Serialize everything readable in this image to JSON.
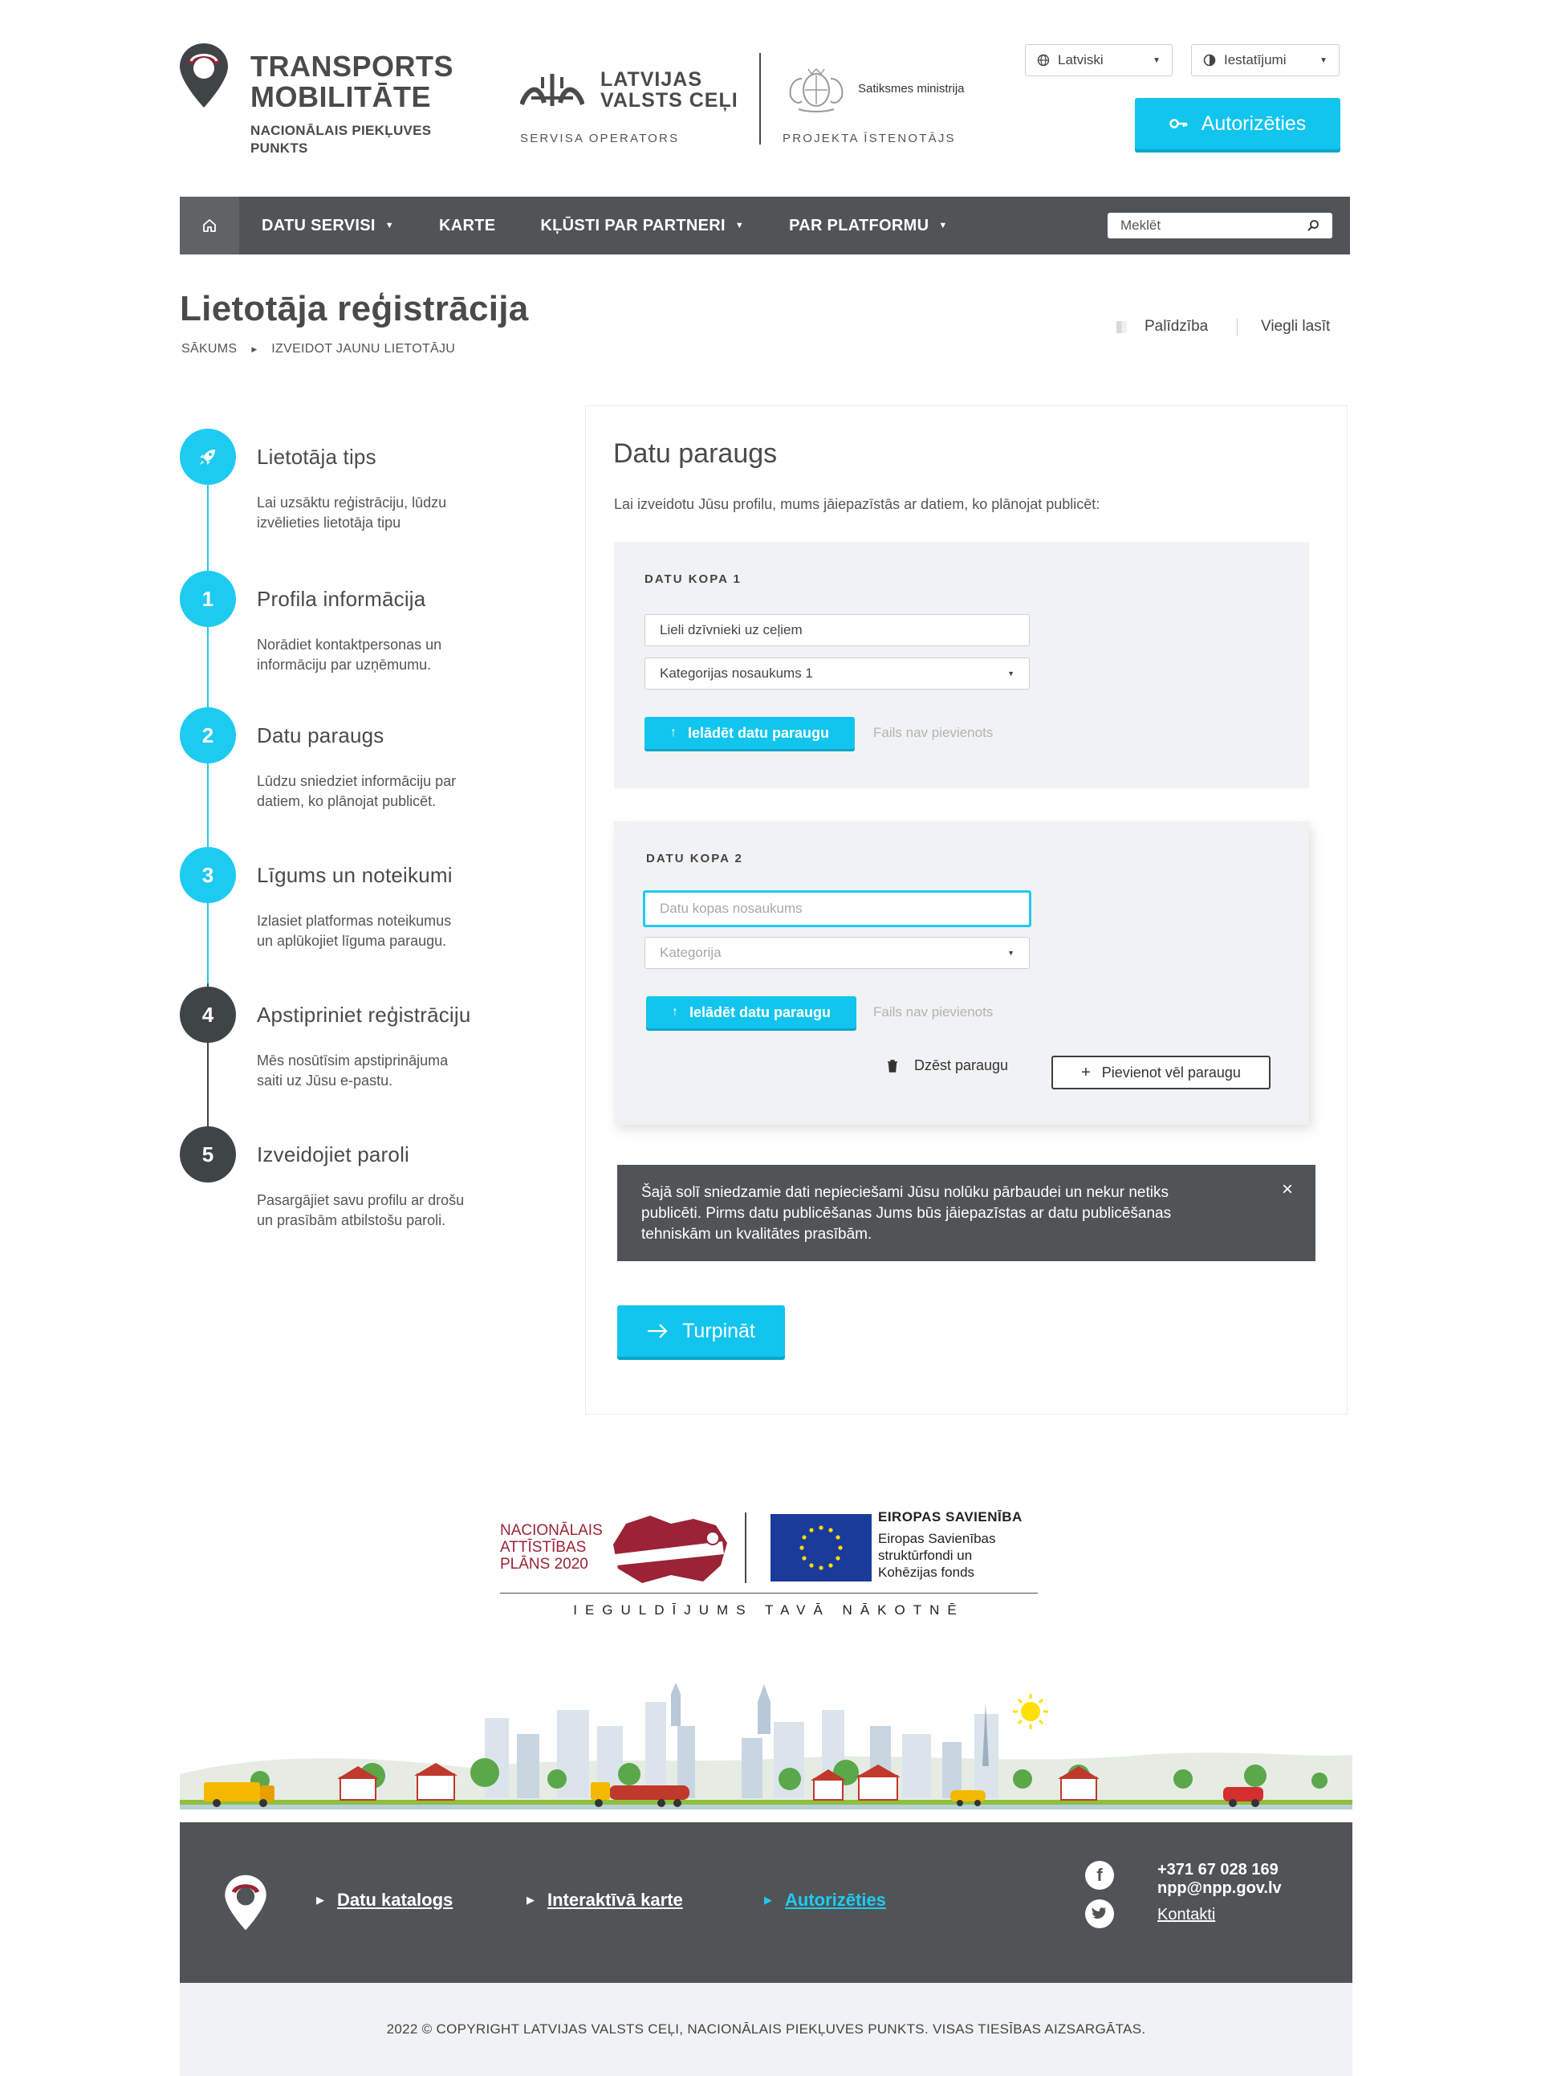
{
  "header": {
    "logo_line1": "TRANSPORTS",
    "logo_line2": "MOBILITĀTE",
    "logo_sub1": "NACIONĀLAIS PIEKĻUVES",
    "logo_sub2": "PUNKTS",
    "lvc_line1": "LATVIJAS",
    "lvc_line2": "VALSTS CEĻI",
    "lvc_caption": "SERVISA OPERATORS",
    "ministry_name": "Satiksmes ministrija",
    "ministry_caption": "PROJEKTA ĪSTENOTĀJS",
    "language": "Latviski",
    "settings": "Iestatījumi",
    "login": "Autorizēties"
  },
  "nav": {
    "items": [
      {
        "label": "DATU SERVISI",
        "dropdown": true
      },
      {
        "label": "KARTE",
        "dropdown": false
      },
      {
        "label": "KĻŪSTI PAR PARTNERI",
        "dropdown": true
      },
      {
        "label": "PAR PLATFORMU",
        "dropdown": true
      }
    ],
    "search_placeholder": "Meklēt"
  },
  "page": {
    "title": "Lietotāja reģistrācija",
    "breadcrumb": [
      "SĀKUMS",
      "IZVEIDOT JAUNU LIETOTĀJU"
    ],
    "help": "Palīdzība",
    "easy_read": "Viegli lasīt"
  },
  "steps": [
    {
      "marker": "",
      "icon": "rocket-icon",
      "title": "Lietotāja tips",
      "desc1": "Lai uzsāktu reģistrāciju, lūdzu",
      "desc2": "izvēlieties lietotāja tipu",
      "state": "done"
    },
    {
      "marker": "1",
      "title": "Profila informācija",
      "desc1": "Norādiet kontaktpersonas un",
      "desc2": "informāciju par uzņēmumu.",
      "state": "done"
    },
    {
      "marker": "2",
      "title": "Datu paraugs",
      "desc1": "Lūdzu sniedziet informāciju par",
      "desc2": "datiem, ko plānojat publicēt.",
      "state": "active"
    },
    {
      "marker": "3",
      "title": "Līgums un noteikumi",
      "desc1": "Izlasiet platformas noteikumus",
      "desc2": "un aplūkojiet līguma paraugu.",
      "state": "active"
    },
    {
      "marker": "4",
      "title": "Apstipriniet reģistrāciju",
      "desc1": "Mēs nosūtīsim apstiprinājuma",
      "desc2": "saiti uz Jūsu e-pastu.",
      "state": "pending"
    },
    {
      "marker": "5",
      "title": "Izveidojiet paroli",
      "desc1": "Pasargājiet savu profilu ar drošu",
      "desc2": "un prasībām atbilstošu paroli.",
      "state": "pending"
    }
  ],
  "form": {
    "title": "Datu paraugs",
    "description": "Lai izveidotu Jūsu profilu, mums jāiepazīstās ar datiem, ko plānojat publicēt:",
    "set1": {
      "label": "DATU KOPA 1",
      "name_value": "Lieli dzīvnieki uz ceļiem",
      "category_value": "Kategorijas nosaukums 1",
      "upload": "Ielādēt datu paraugu",
      "file_status": "Fails nav pievienots"
    },
    "set2": {
      "label": "DATU KOPA 2",
      "name_placeholder": "Datu kopas nosaukums",
      "category_placeholder": "Kategorija",
      "upload": "Ielādēt datu paraugu",
      "file_status": "Fails nav pievienots",
      "delete": "Dzēst paraugu",
      "add_more": "Pievienot vēl paraugu"
    },
    "notice_line1": "Šajā solī sniedzamie dati nepieciešami Jūsu nolūku pārbaudei un nekur netiks",
    "notice_line2": "publicēti. Pirms datu publicēšanas Jums būs jāiepazīstas ar datu publicēšanas",
    "notice_line3": "tehniskām un kvalitātes prasībām.",
    "continue": "Turpināt"
  },
  "eu": {
    "nap_line1": "NACIONĀLAIS",
    "nap_line2": "ATTĪSTĪBAS",
    "nap_line3": "PLĀNS 2020",
    "eu_title": "EIROPAS SAVIENĪBA",
    "eu_line1": "Eiropas Savienības",
    "eu_line2": "struktūrfondi un",
    "eu_line3": "Kohēzijas fonds",
    "slogan": "IEGULDĪJUMS TAVĀ NĀKOTNĒ"
  },
  "footer": {
    "links": [
      {
        "label": "Datu katalogs"
      },
      {
        "label": "Interaktīvā karte"
      },
      {
        "label": "Autorizēties"
      }
    ],
    "phone": "+371 67 028 169",
    "email": "npp@npp.gov.lv",
    "contacts": "Kontakti",
    "copyright": "2022 © COPYRIGHT LATVIJAS VALSTS CEĻI, NACIONĀLAIS PIEKĻUVES PUNKTS. VISAS TIESĪBAS AIZSARGĀTAS."
  },
  "colors": {
    "accent": "#11c5ee",
    "dark": "#505457",
    "brand_red": "#9b2335"
  }
}
